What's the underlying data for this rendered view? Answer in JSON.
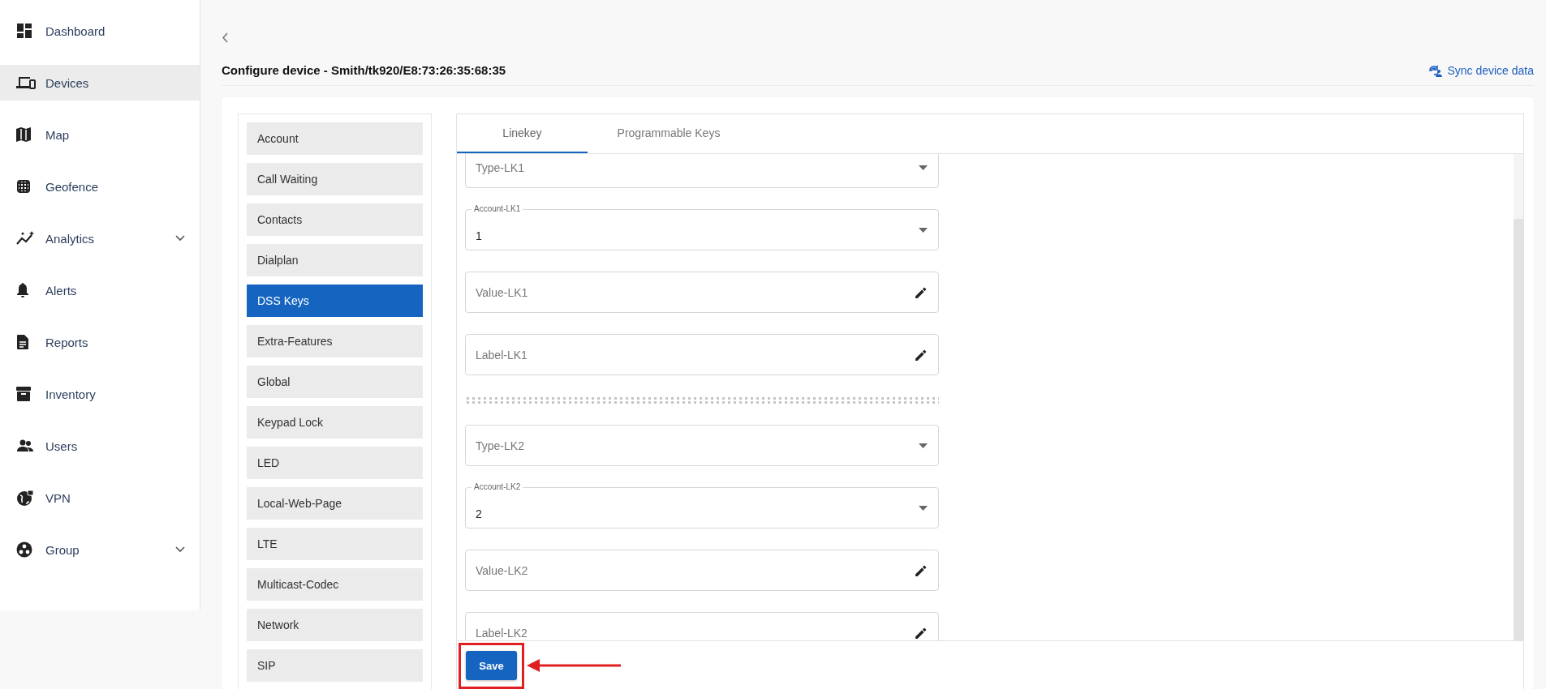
{
  "sidebar": {
    "items": [
      {
        "label": "Dashboard",
        "kind": "link",
        "selected": false
      },
      {
        "label": "Devices",
        "kind": "link",
        "selected": true
      },
      {
        "label": "Map",
        "kind": "link",
        "selected": false
      },
      {
        "label": "Geofence",
        "kind": "link",
        "selected": false
      },
      {
        "label": "Analytics",
        "kind": "group",
        "selected": false
      },
      {
        "label": "Alerts",
        "kind": "link",
        "selected": false
      },
      {
        "label": "Reports",
        "kind": "link",
        "selected": false
      },
      {
        "label": "Inventory",
        "kind": "link",
        "selected": false
      },
      {
        "label": "Users",
        "kind": "link",
        "selected": false
      },
      {
        "label": "VPN",
        "kind": "link",
        "selected": false
      },
      {
        "label": "Group",
        "kind": "group",
        "selected": false
      }
    ]
  },
  "page": {
    "title": "Configure device - Smith/tk920/E8:73:26:35:68:35",
    "sync_link": "Sync device data"
  },
  "settings_menu": {
    "items": [
      {
        "label": "Account",
        "selected": false
      },
      {
        "label": "Call Waiting",
        "selected": false
      },
      {
        "label": "Contacts",
        "selected": false
      },
      {
        "label": "Dialplan",
        "selected": false
      },
      {
        "label": "DSS Keys",
        "selected": true
      },
      {
        "label": "Extra-Features",
        "selected": false
      },
      {
        "label": "Global",
        "selected": false
      },
      {
        "label": "Keypad Lock",
        "selected": false
      },
      {
        "label": "LED",
        "selected": false
      },
      {
        "label": "Local-Web-Page",
        "selected": false
      },
      {
        "label": "LTE",
        "selected": false
      },
      {
        "label": "Multicast-Codec",
        "selected": false
      },
      {
        "label": "Network",
        "selected": false
      },
      {
        "label": "SIP",
        "selected": false
      }
    ]
  },
  "tabs": [
    {
      "label": "Linekey",
      "selected": true
    },
    {
      "label": "Programmable Keys",
      "selected": false
    }
  ],
  "fields": [
    {
      "kind": "select",
      "placeholder": "Type-LK1"
    },
    {
      "kind": "select",
      "label": "Account-LK1",
      "value": "1"
    },
    {
      "kind": "text",
      "placeholder": "Value-LK1"
    },
    {
      "kind": "text",
      "placeholder": "Label-LK1"
    },
    {
      "kind": "divider"
    },
    {
      "kind": "select",
      "placeholder": "Type-LK2"
    },
    {
      "kind": "select",
      "label": "Account-LK2",
      "value": "2"
    },
    {
      "kind": "text",
      "placeholder": "Value-LK2"
    },
    {
      "kind": "text",
      "placeholder": "Label-LK2"
    }
  ],
  "save_button": "Save"
}
